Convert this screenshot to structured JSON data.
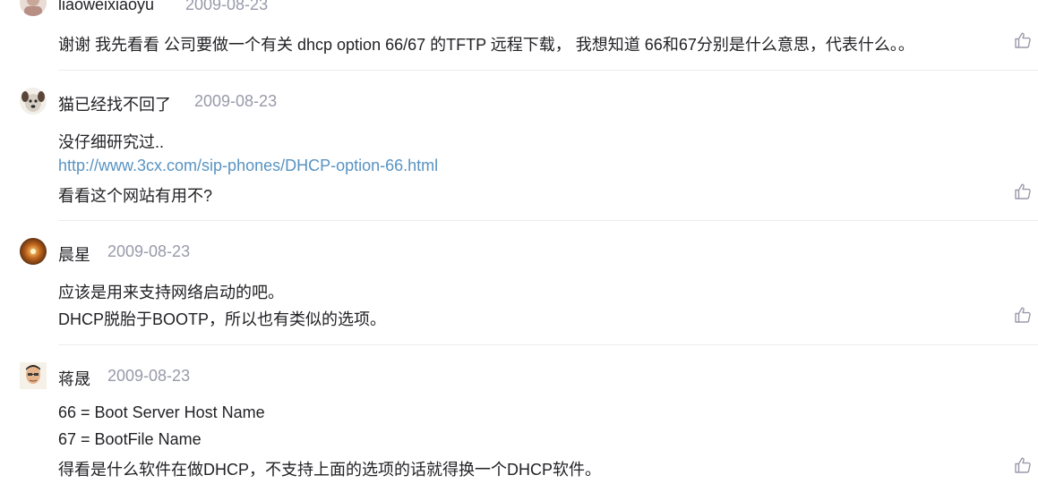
{
  "comments": [
    {
      "avatar": "user-avatar-photo",
      "name": "liaoweixiaoyu",
      "date": "2009-08-23",
      "lines": [
        {
          "text": "谢谢 我先看看 公司要做一个有关 dhcp option 66/67 的TFTP 远程下载， 我想知道 66和67分别是什么意思，代表什么。。",
          "link": false
        }
      ],
      "like_icon": "thumbs-up-icon"
    },
    {
      "avatar": "user-avatar-dog",
      "name": "猫已经找不回了",
      "date": "2009-08-23",
      "lines": [
        {
          "text": "没仔细研究过..",
          "link": false
        },
        {
          "text": "http://www.3cx.com/sip-phones/DHCP-option-66.html",
          "link": true
        },
        {
          "text": "看看这个网站有用不?",
          "link": false
        }
      ],
      "like_icon": "thumbs-up-icon"
    },
    {
      "avatar": "user-avatar-sparkle",
      "name": "晨星",
      "date": "2009-08-23",
      "lines": [
        {
          "text": "应该是用来支持网络启动的吧。",
          "link": false
        },
        {
          "text": "DHCP脱胎于BOOTP，所以也有类似的选项。",
          "link": false
        }
      ],
      "like_icon": "thumbs-up-icon"
    },
    {
      "avatar": "user-avatar-person",
      "name": "蒋晟",
      "date": "2009-08-23",
      "lines": [
        {
          "text": "66 = Boot Server Host Name",
          "link": false
        },
        {
          "text": "67 = BootFile Name",
          "link": false
        },
        {
          "text": "得看是什么软件在做DHCP，不支持上面的选项的话就得换一个DHCP软件。",
          "link": false
        }
      ],
      "like_icon": "thumbs-up-icon"
    }
  ],
  "colors": {
    "text": "#222226",
    "date": "#999aaa",
    "link": "#5893c2",
    "divider": "#ededed",
    "like_icon": "#999aaa"
  }
}
